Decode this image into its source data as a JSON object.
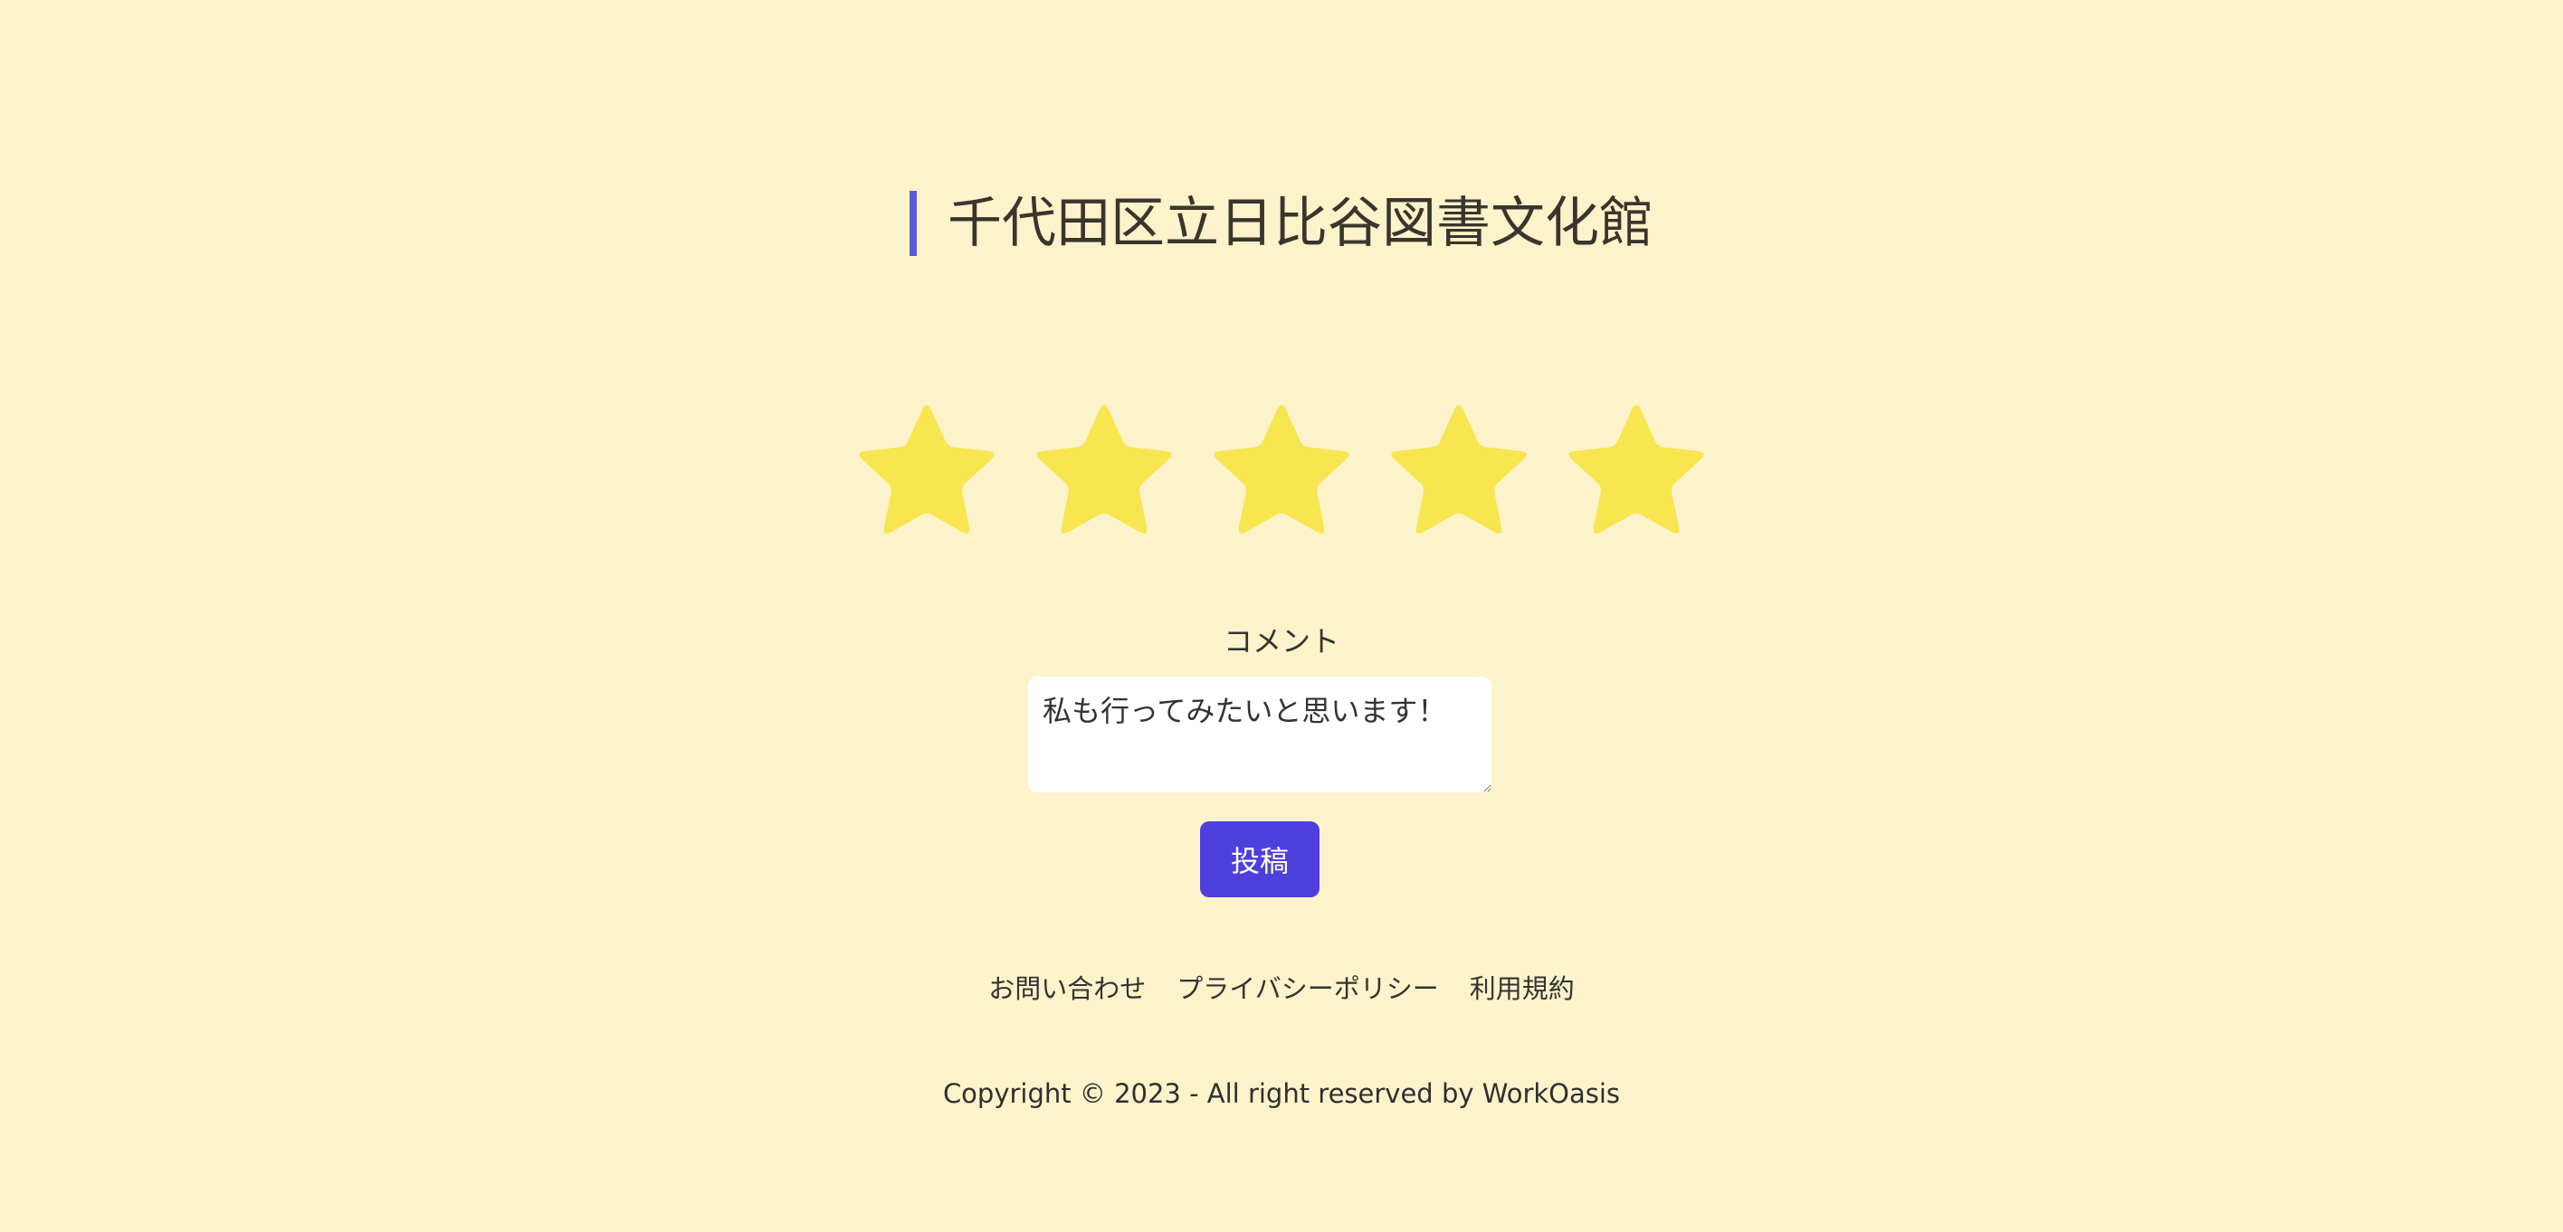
{
  "page": {
    "title": "千代田区立日比谷図書文化館"
  },
  "rating": {
    "value": 5,
    "max": 5,
    "star_color": "#f7e64f",
    "icon": "star-icon"
  },
  "comment": {
    "label": "コメント",
    "value": "私も行ってみたいと思います！"
  },
  "submit": {
    "label": "投稿"
  },
  "footer": {
    "links": [
      {
        "label": "お問い合わせ"
      },
      {
        "label": "プライバシーポリシー"
      },
      {
        "label": "利用規約"
      }
    ],
    "copyright": "Copyright © 2023 - All right reserved by WorkOasis"
  },
  "colors": {
    "background": "#fcf3cb",
    "accent": "#5b5bd6",
    "button": "#4f3fdc"
  }
}
